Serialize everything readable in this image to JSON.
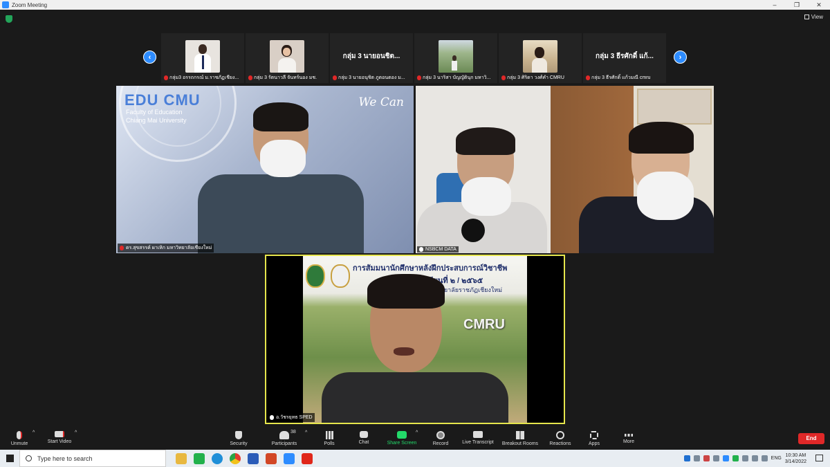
{
  "window": {
    "title": "Zoom Meeting",
    "controls": [
      "–",
      "❐",
      "✕"
    ]
  },
  "header": {
    "view_label": "View"
  },
  "thumbnails": [
    {
      "name": "กลุ่ม3 อรรถกรณ์ ม.ราชภัฏเชียง...",
      "type": "video",
      "color": "#e8e4df"
    },
    {
      "name": "กลุ่ม 3 รัตนาวลี จันทร์นอง มช.",
      "type": "video",
      "color": "#d9cfc6"
    },
    {
      "name": "กลุ่ม 3 นายอนุชิต ภูตอนตอง ม...",
      "type": "name",
      "display": "กลุ่ม 3 นายอนชิต..."
    },
    {
      "name": "กลุ่ม 3 นาริสา บัญญัตินุก มหาวิ...",
      "type": "video",
      "color": "#8fae7a"
    },
    {
      "name": "กลุ่ม 3 ศิริดา วงศ์คำ CMRU",
      "type": "video",
      "color": "#c9b38f"
    },
    {
      "name": "กลุ่ม 3 ธีรศักดิ์ แก้วมณี cmru",
      "type": "name",
      "display": "กลุ่ม 3 ธีรศักดิ์ แก้..."
    }
  ],
  "tiles": {
    "speaker1": {
      "name": "ดร.สุขสรรค์ ผาเหิก มหาวิทยาลัยเชียงใหม่",
      "brand": "EDU CMU",
      "faculty": "Faculty of Education",
      "university": "Chiang Mai University",
      "slogan": "We Can"
    },
    "speaker2": {
      "name": "NSBCM DATA"
    },
    "speaker3": {
      "name": "อ.วัชรยุทธ SPED",
      "banner_line1": "การสัมมนานักศึกษาหลังฝึกประสบการณ์วิชาชีพ",
      "banner_line2": "ภาคเรียนที่ ๒ / ๒๕๖๕",
      "banner_line3": "มหาวิทยาลัยราชภัฏเชียงใหม่",
      "sign": "CMRU"
    }
  },
  "toolbar": {
    "unmute": "Unmute",
    "start_video": "Start Video",
    "security": "Security",
    "participants": "Participants",
    "participants_count": "38",
    "polls": "Polls",
    "chat": "Chat",
    "share_screen": "Share Screen",
    "record": "Record",
    "live_transcript": "Live Transcript",
    "breakout_rooms": "Breakout Rooms",
    "reactions": "Reactions",
    "apps": "Apps",
    "more": "More",
    "end": "End",
    "caret": "^"
  },
  "taskbar": {
    "search_placeholder": "Type here to search",
    "lang": "ENG",
    "time": "10:30 AM",
    "date": "3/14/2022"
  },
  "colors": {
    "accent": "#2d8cff",
    "danger": "#e02828",
    "share_green": "#23d96a",
    "active_speaker": "#e6e64c"
  }
}
